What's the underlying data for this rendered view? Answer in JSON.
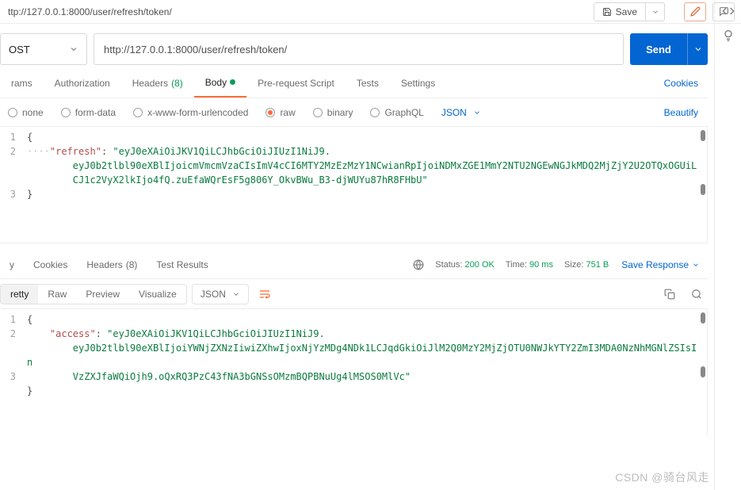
{
  "top": {
    "url": "ttp://127.0.0.1:8000/user/refresh/token/",
    "save": "Save"
  },
  "request": {
    "method": "OST",
    "url": "http://127.0.0.1:8000/user/refresh/token/",
    "send": "Send"
  },
  "req_tabs": {
    "params": "rams",
    "auth": "Authorization",
    "headers": "Headers",
    "headers_count": "(8)",
    "body": "Body",
    "prereq": "Pre-request Script",
    "tests": "Tests",
    "settings": "Settings",
    "cookies": "Cookies"
  },
  "body_types": {
    "none": "none",
    "formdata": "form-data",
    "urlencoded": "x-www-form-urlencoded",
    "raw": "raw",
    "binary": "binary",
    "graphql": "GraphQL",
    "format": "JSON",
    "beautify": "Beautify"
  },
  "req_body": {
    "key": "\"refresh\"",
    "val1": "\"eyJ0eXAiOiJKV1QiLCJhbGciOiJIUzI1NiJ9.",
    "val2": "eyJ0b2tlbl90eXBlIjoicmVmcmVzaCIsImV4cCI6MTY2MzEzMzY1NCwianRpIjoiNDMxZGE1MmY2NTU2NGEwNGJkMDQ2MjZjY2U2OTQxOGUiL",
    "val3": "CJ1c2VyX2lkIjo4fQ.zuEfaWQrEsF5g806Y_OkvBWu_B3-djWUYu87hR8FHbU\""
  },
  "resp_tabs": {
    "body": "y",
    "cookies": "Cookies",
    "headers": "Headers",
    "headers_count": "(8)",
    "tests": "Test Results"
  },
  "status": {
    "status_lbl": "Status:",
    "status_val": "200 OK",
    "time_lbl": "Time:",
    "time_val": "90 ms",
    "size_lbl": "Size:",
    "size_val": "751 B",
    "save_resp": "Save Response"
  },
  "resp_tools": {
    "pretty": "retty",
    "raw": "Raw",
    "preview": "Preview",
    "visualize": "Visualize",
    "format": "JSON"
  },
  "resp_body": {
    "key": "\"access\"",
    "val1": "\"eyJ0eXAiOiJKV1QiLCJhbGciOiJIUzI1NiJ9.",
    "val2": "eyJ0b2tlbl90eXBlIjoiYWNjZXNzIiwiZXhwIjoxNjYzMDg4NDk1LCJqdGkiOiJlM2Q0MzY2MjZjOTU0NWJkYTY2ZmI3MDA0NzNhMGNlZSIsIn",
    "val3": "VzZXJfaWQiOjh9.oQxRQ3PzC43fNA3bGNSsOMzmBQPBNuUg4lMSOS0MlVc\""
  },
  "watermark": "CSDN @骑台风走"
}
